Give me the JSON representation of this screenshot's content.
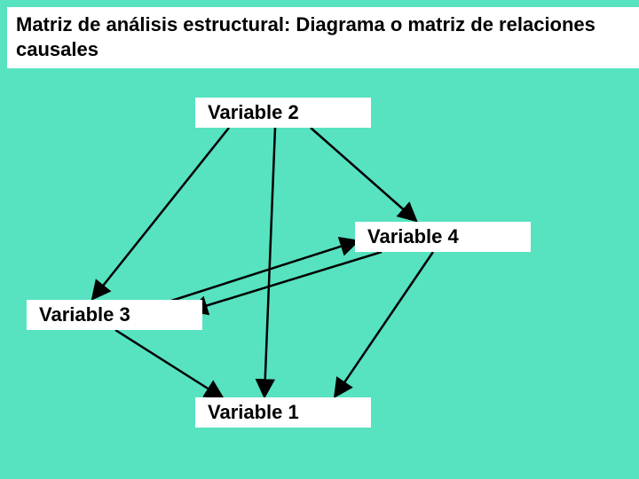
{
  "title": "Matriz de análisis estructural: Diagrama o matriz de relaciones causales",
  "nodes": {
    "v1": "Variable 1",
    "v2": "Variable 2",
    "v3": "Variable 3",
    "v4": "Variable 4"
  },
  "edges": [
    {
      "from": "v2",
      "to": "v3"
    },
    {
      "from": "v2",
      "to": "v1"
    },
    {
      "from": "v2",
      "to": "v4"
    },
    {
      "from": "v4",
      "to": "v3"
    },
    {
      "from": "v4",
      "to": "v1"
    },
    {
      "from": "v3",
      "to": "v4"
    },
    {
      "from": "v3",
      "to": "v1"
    }
  ]
}
